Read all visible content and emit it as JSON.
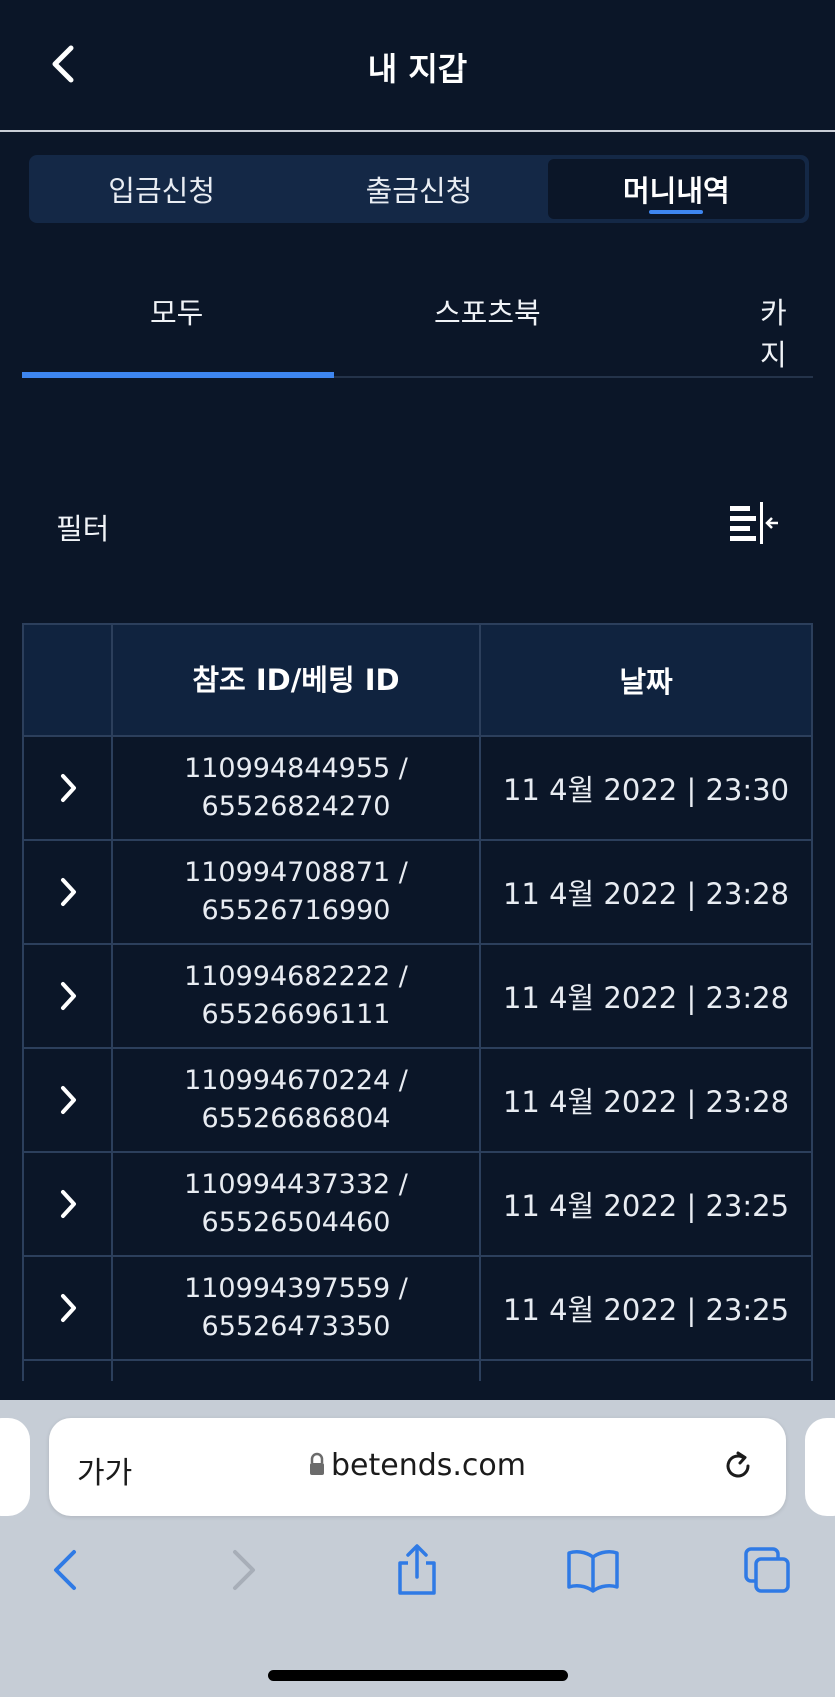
{
  "header": {
    "title": "내 지갑"
  },
  "segments": [
    {
      "label": "입금신청",
      "active": false
    },
    {
      "label": "출금신청",
      "active": false
    },
    {
      "label": "머니내역",
      "active": true
    }
  ],
  "subtabs": [
    {
      "label": "모두",
      "active": true
    },
    {
      "label": "스포츠북",
      "active": false
    },
    {
      "label": "카지",
      "active": false
    }
  ],
  "filter": {
    "label": "필터",
    "icon": "filter-collapse-icon"
  },
  "table": {
    "columns": [
      "",
      "참조 ID/베팅 ID",
      "날짜"
    ],
    "rows": [
      {
        "ref_id": "110994844955 /",
        "bet_id": "65526824270",
        "date": "11 4월 2022 | 23:30"
      },
      {
        "ref_id": "110994708871 /",
        "bet_id": "65526716990",
        "date": "11 4월 2022 | 23:28"
      },
      {
        "ref_id": "110994682222 /",
        "bet_id": "65526696111",
        "date": "11 4월 2022 | 23:28"
      },
      {
        "ref_id": "110994670224 /",
        "bet_id": "65526686804",
        "date": "11 4월 2022 | 23:28"
      },
      {
        "ref_id": "110994437332 /",
        "bet_id": "65526504460",
        "date": "11 4월 2022 | 23:25"
      },
      {
        "ref_id": "110994397559 /",
        "bet_id": "65526473350",
        "date": "11 4월 2022 | 23:25"
      }
    ]
  },
  "browser": {
    "text_size_label": "가가",
    "url": "betends.com"
  },
  "colors": {
    "background": "#0b1628",
    "accent": "#3e86f0",
    "table_header": "#10233f",
    "browser_chrome": "#c6cdd6",
    "browser_icon": "#2f7ae5"
  }
}
